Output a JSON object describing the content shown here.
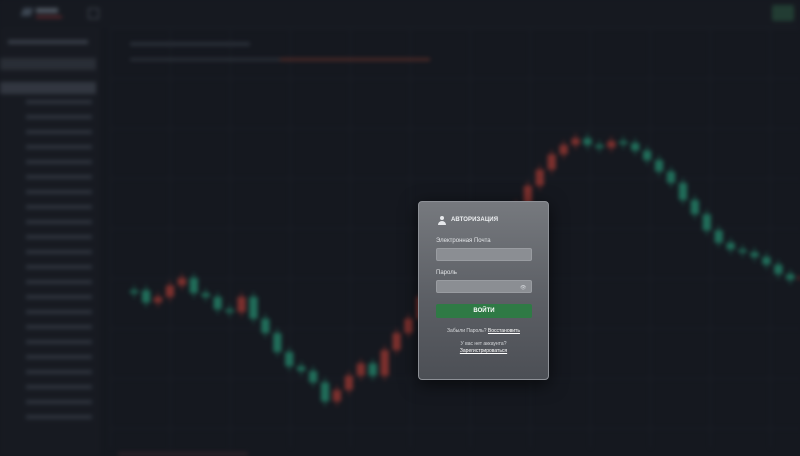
{
  "modal": {
    "title": "АВТОРИЗАЦИЯ",
    "email_label": "Электронная Почта",
    "email_value": "",
    "password_label": "Пароль",
    "password_value": "",
    "show_password_glyph": "👁",
    "login_button": "ВОЙТИ",
    "forgot_text": "Забыли Пароль?",
    "restore_link": "Восстановить",
    "no_account_text": "У вас нет аккаунта?",
    "register_link": "Зарегистрироваться"
  },
  "colors": {
    "background": "#15181f",
    "accent_green": "#2f7a45",
    "candle_up": "#2bb38a",
    "candle_down": "#d0453a"
  },
  "background_app": {
    "chart_type": "candlestick",
    "blurred": true,
    "candle_close_series": [
      255,
      268,
      262,
      250,
      242,
      258,
      262,
      275,
      278,
      262,
      285,
      300,
      320,
      335,
      340,
      352,
      372,
      360,
      345,
      332,
      345,
      318,
      300,
      285,
      262,
      240,
      225,
      220,
      212,
      200,
      188,
      175,
      165,
      145,
      128,
      112,
      102,
      95,
      102,
      105,
      98,
      100,
      108,
      118,
      130,
      142,
      160,
      175,
      192,
      205,
      212,
      215,
      220,
      228,
      238,
      244,
      240
    ]
  }
}
